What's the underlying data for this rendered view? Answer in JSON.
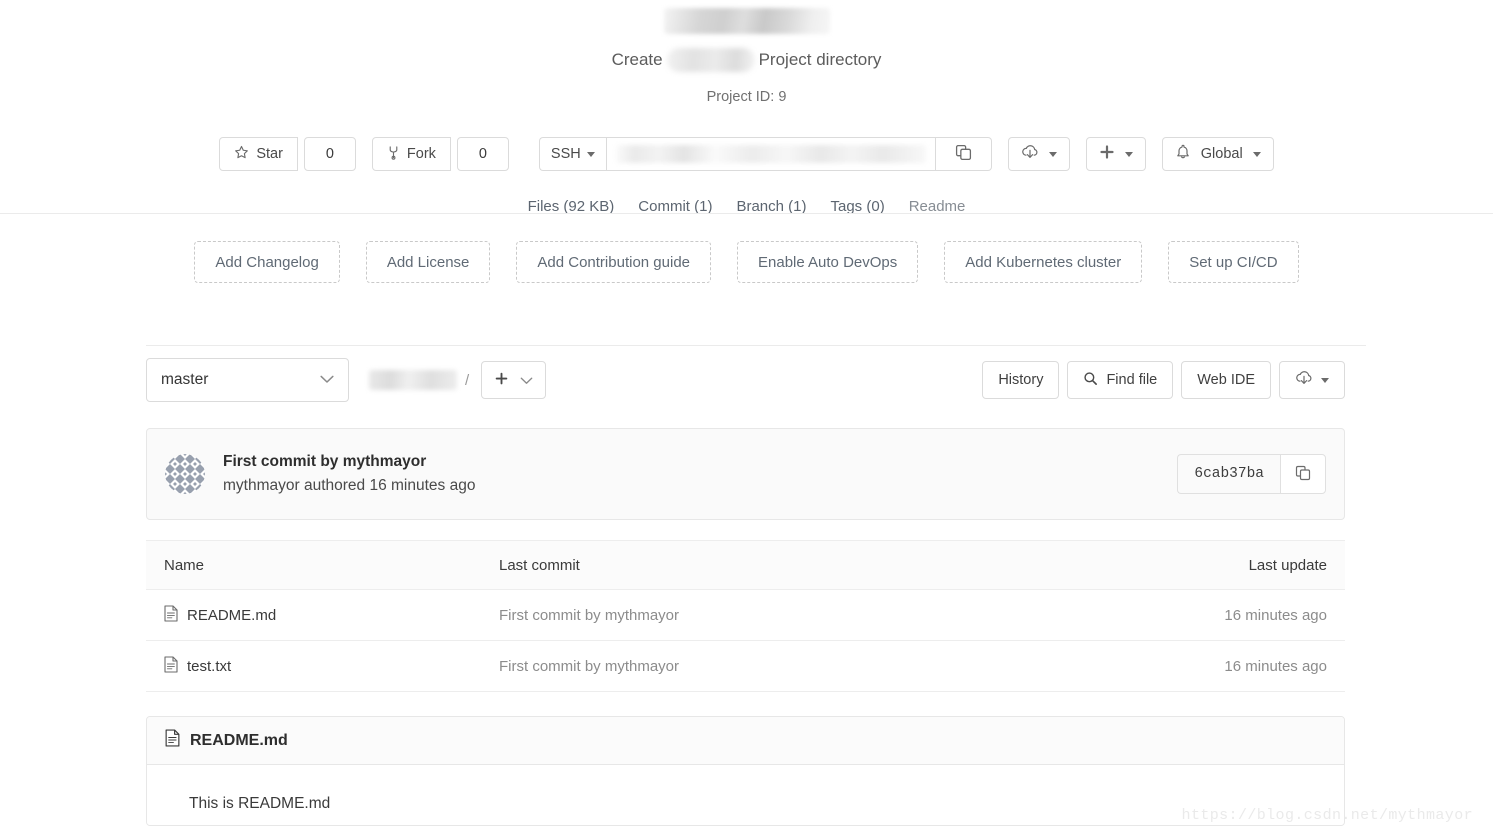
{
  "header": {
    "project_title_redacted": true,
    "subtitle_prefix": "Create",
    "subtitle_suffix": "Project directory",
    "project_id": "Project ID: 9"
  },
  "toolbar": {
    "star_label": "Star",
    "star_count": "0",
    "fork_label": "Fork",
    "fork_count": "0",
    "clone_protocol": "SSH",
    "clone_url_redacted": true,
    "copy_icon": "copy-icon",
    "download_icon": "cloud-download-icon",
    "plus_icon": "plus-icon",
    "notification_icon": "bell-icon",
    "notification_label": "Global"
  },
  "stats": [
    {
      "label": "Files (92 KB)",
      "muted": false
    },
    {
      "label": "Commit (1)",
      "muted": false
    },
    {
      "label": "Branch (1)",
      "muted": false
    },
    {
      "label": "Tags (0)",
      "muted": false
    },
    {
      "label": "Readme",
      "muted": true
    }
  ],
  "suggestions": [
    "Add Changelog",
    "Add License",
    "Add Contribution guide",
    "Enable Auto DevOps",
    "Add Kubernetes cluster",
    "Set up CI/CD"
  ],
  "file_controls": {
    "branch": "master",
    "breadcrumb_redacted": true,
    "breadcrumb_separator": "/",
    "add_label": "+",
    "history_label": "History",
    "find_file_label": "Find file",
    "find_file_icon": "search-icon",
    "web_ide_label": "Web IDE",
    "download_icon": "cloud-download-icon"
  },
  "commit": {
    "title": "First commit by mythmayor",
    "author_line": "mythmayor authored 16 minutes ago",
    "hash": "6cab37ba",
    "copy_icon": "copy-icon",
    "avatar": "identicon-avatar"
  },
  "file_table": {
    "columns": [
      "Name",
      "Last commit",
      "Last update"
    ],
    "rows": [
      {
        "name": "README.md",
        "icon": "file-icon",
        "last_commit": "First commit by mythmayor",
        "last_update": "16 minutes ago"
      },
      {
        "name": "test.txt",
        "icon": "file-icon",
        "last_commit": "First commit by mythmayor",
        "last_update": "16 minutes ago"
      }
    ]
  },
  "readme": {
    "filename": "README.md",
    "icon": "file-icon",
    "content": "This is README.md"
  },
  "watermark": "https://blog.csdn.net/mythmayor",
  "colors": {
    "border": "#dbdbdb",
    "divider": "#ebebeb",
    "muted_text": "#8c8c8c",
    "panel_bg": "#fafafa"
  }
}
